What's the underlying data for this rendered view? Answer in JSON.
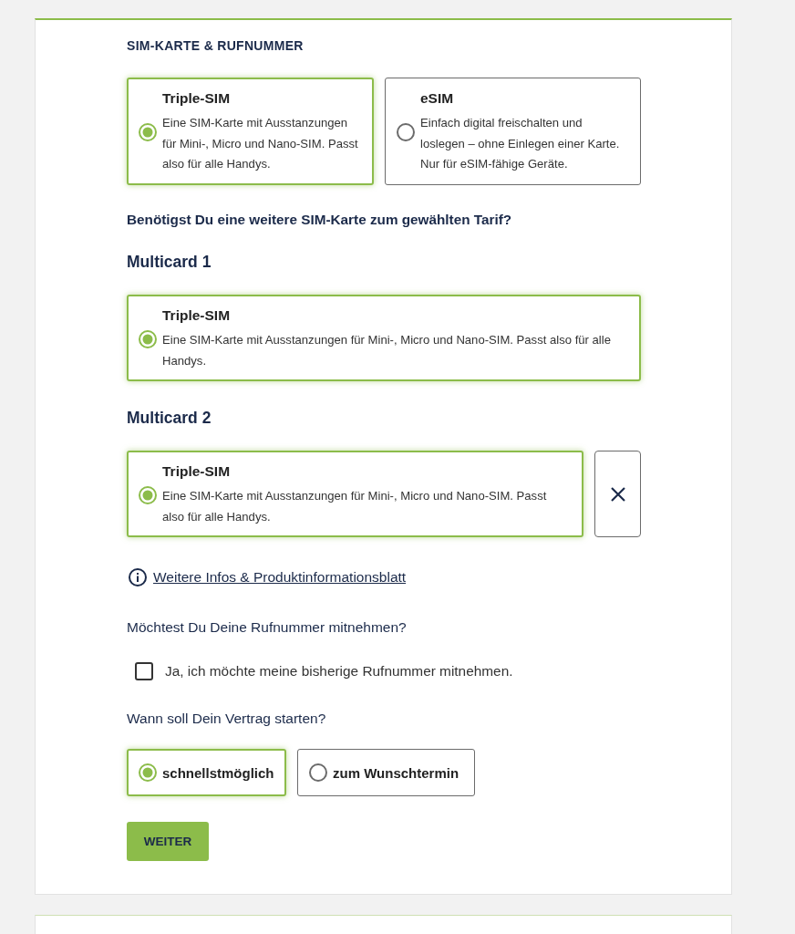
{
  "section_title": "SIM-KARTE & RUFNUMMER",
  "sim_options": [
    {
      "title": "Triple-SIM",
      "description": "Eine SIM-Karte mit Ausstanzungen für Mini-, Micro und Nano-SIM. Passt also für alle Handys.",
      "selected": true
    },
    {
      "title": "eSIM",
      "description": "Einfach digital freischalten und loslegen – ohne Einlegen einer Karte. Nur für eSIM-fähige Geräte.",
      "selected": false
    }
  ],
  "multicard_question": "Benötigst Du eine weitere SIM-Karte zum gewählten Tarif?",
  "multicards": [
    {
      "heading": "Multicard 1",
      "option": {
        "title": "Triple-SIM",
        "description": "Eine SIM-Karte mit Ausstanzungen für Mini-, Micro und Nano-SIM. Passt also für alle Handys.",
        "selected": true
      },
      "removable": false
    },
    {
      "heading": "Multicard 2",
      "option": {
        "title": "Triple-SIM",
        "description": "Eine SIM-Karte mit Ausstanzungen für Mini-, Micro und Nano-SIM. Passt also für alle Handys.",
        "selected": true
      },
      "removable": true
    }
  ],
  "info_link": "Weitere Infos & Produktinformationsblatt",
  "number_question": "Möchtest Du Deine Rufnummer mitnehmen?",
  "number_checkbox": {
    "label": "Ja, ich möchte meine bisherige Rufnummer mitnehmen.",
    "checked": false
  },
  "start_question": "Wann soll Dein Vertrag starten?",
  "start_options": [
    {
      "label": "schnellstmöglich",
      "selected": true
    },
    {
      "label": "zum Wunschtermin",
      "selected": false
    }
  ],
  "continue_button": "WEITER"
}
